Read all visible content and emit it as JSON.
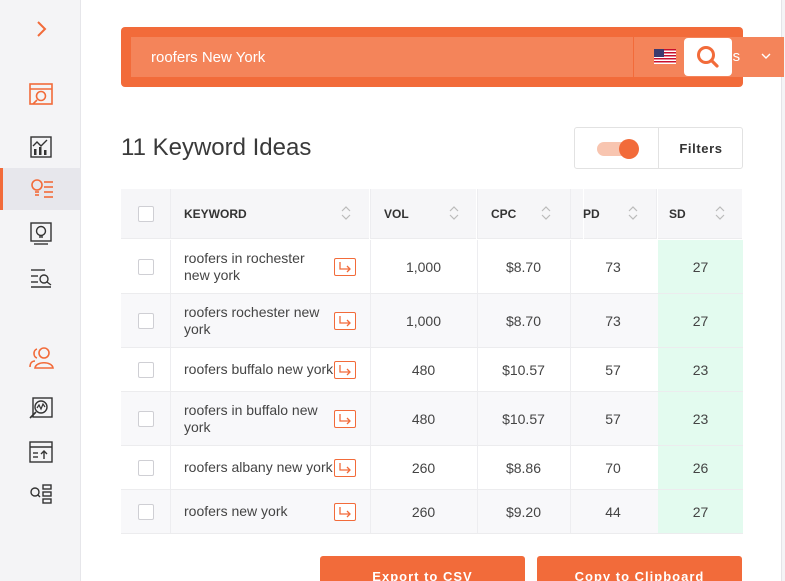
{
  "search": {
    "query": "roofers New York",
    "language": "En / Us"
  },
  "results_title": "11 Keyword Ideas",
  "filters_label": "Filters",
  "table": {
    "headers": {
      "keyword": "KEYWORD",
      "vol": "VOL",
      "cpc": "CPC",
      "pd": "PD",
      "sd": "SD"
    },
    "rows": [
      {
        "keyword": "roofers in rochester new york",
        "vol": "1,000",
        "cpc": "$8.70",
        "pd": "73",
        "sd": "27"
      },
      {
        "keyword": "roofers rochester new york",
        "vol": "1,000",
        "cpc": "$8.70",
        "pd": "73",
        "sd": "27"
      },
      {
        "keyword": "roofers buffalo new york",
        "vol": "480",
        "cpc": "$10.57",
        "pd": "57",
        "sd": "23"
      },
      {
        "keyword": "roofers in buffalo new york",
        "vol": "480",
        "cpc": "$10.57",
        "pd": "57",
        "sd": "23"
      },
      {
        "keyword": "roofers albany new york",
        "vol": "260",
        "cpc": "$8.86",
        "pd": "70",
        "sd": "26"
      },
      {
        "keyword": "roofers new york",
        "vol": "260",
        "cpc": "$9.20",
        "pd": "44",
        "sd": "27"
      }
    ]
  },
  "buttons": {
    "export_csv": "Export to CSV",
    "copy_clipboard": "Copy to Clipboard"
  },
  "colors": {
    "accent": "#f26b3a",
    "sd_highlight": "#e3fbef"
  },
  "icons": [
    "expand-chevron-icon",
    "dashboard-icon",
    "chart-icon",
    "keyword-ideas-icon",
    "content-ideas-icon",
    "site-audit-icon",
    "user-group-icon",
    "analytics-icon",
    "rank-tracker-icon",
    "list-search-icon",
    "search-icon",
    "us-flag-icon",
    "chevron-down-icon",
    "external-link-icon"
  ]
}
